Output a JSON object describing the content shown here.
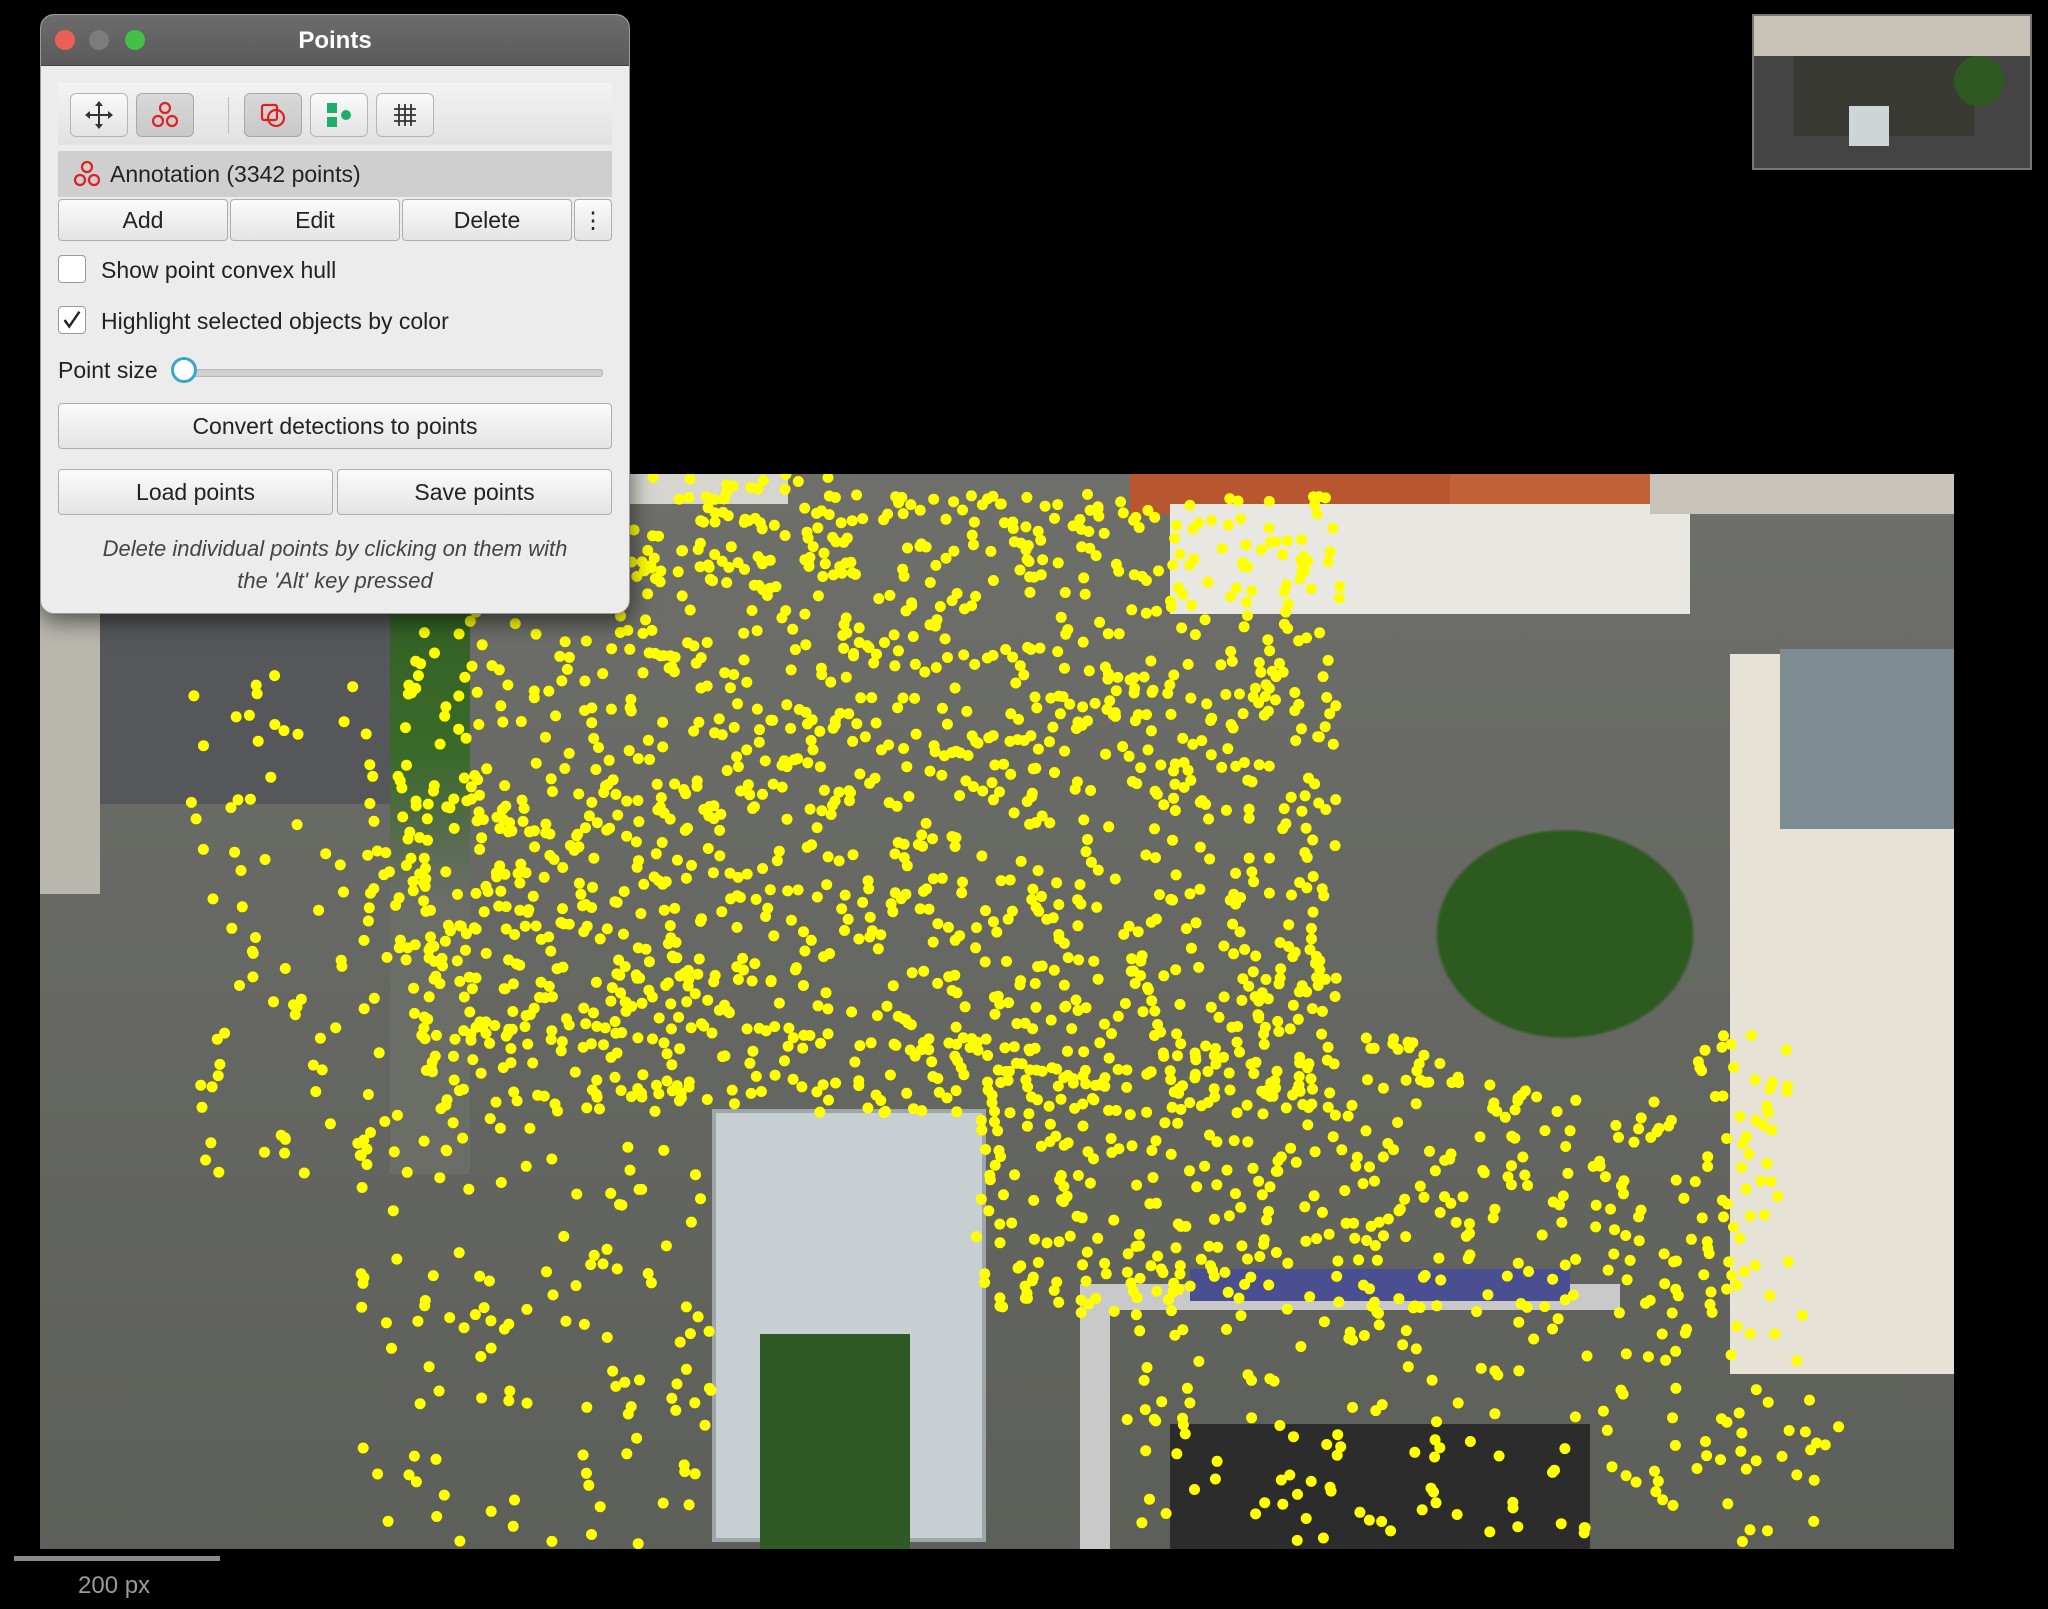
{
  "dialog": {
    "title": "Points",
    "toolbar": {
      "tools": [
        {
          "name": "move-tool",
          "icon": "move-icon",
          "active": false
        },
        {
          "name": "points-tool",
          "icon": "points-icon",
          "active": true
        },
        {
          "name": "show-annotations-toggle",
          "icon": "annotations-icon",
          "active": true
        },
        {
          "name": "show-detections-toggle",
          "icon": "detections-icon",
          "active": false
        },
        {
          "name": "grid-toggle",
          "icon": "grid-icon",
          "active": false
        }
      ]
    },
    "annotation_label": "Annotation (3342 points)",
    "buttons": {
      "add": "Add",
      "edit": "Edit",
      "delete": "Delete",
      "more": "⋮",
      "convert": "Convert detections to points",
      "load": "Load points",
      "save": "Save points"
    },
    "checkboxes": {
      "convex_hull": {
        "label": "Show point convex hull",
        "checked": false
      },
      "highlight": {
        "label": "Highlight selected objects by color",
        "checked": true
      }
    },
    "point_size": {
      "label": "Point size",
      "value": 0.0
    },
    "hint_line1": "Delete individual points by clicking on them with",
    "hint_line2": "the 'Alt' key pressed"
  },
  "scalebar": {
    "label": "200 px"
  },
  "colors": {
    "point": "#ffff00",
    "points_icon": "#e02020",
    "detections_icon": "#1fae6a",
    "slider_accent": "#3aa7c8"
  }
}
